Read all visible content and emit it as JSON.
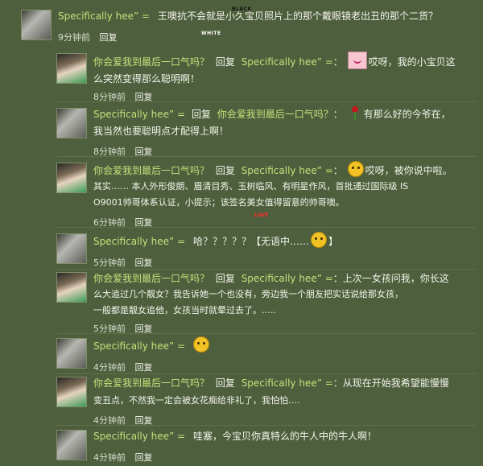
{
  "deco": {
    "black": "BLACK",
    "white": "WHITE",
    "love": "LOVE"
  },
  "comments": [
    {
      "user": "Specifically hee” =",
      "text": "王噢抗不会就是小久宝贝照片上的那个戴眼镜老出丑的那个二货？",
      "time": "9分钟前",
      "reply": "回复"
    },
    {
      "user": "你会爱我到最后一口气吗？",
      "mid": "回复",
      "target": "Specifically hee” =",
      "text1": "：",
      "text2": "哎呀，我的小宝贝这",
      "line2": "么突然变得那么聪明啊！",
      "time": "8分钟前",
      "reply": "回复"
    },
    {
      "user": "Specifically hee” =",
      "mid": "回复",
      "target": "你会爱我到最后一口气吗？",
      "text1": "：",
      "text2": "有那么好的今爷在，",
      "line2": "我当然也要聪明点才配得上啊！",
      "time": "8分钟前",
      "reply": "回复"
    },
    {
      "user": "你会爱我到最后一口气吗？",
      "mid": "回复",
      "target": "Specifically hee” =",
      "text1": "：",
      "text2": "哎呀，被你说中啦。",
      "line2": "其实…… 本人外形俊朗、眉清目秀、玉树临风、有明星作风，首批通过国际级 IS",
      "line3": "O9001帅哥体系认证，小提示；该签名美女值得留意的帅哥噢。",
      "time": "6分钟前",
      "reply": "回复"
    },
    {
      "user": "Specifically hee” =",
      "text1": "哈？？？？？【无语中……",
      "text2": "】",
      "time": "5分钟前",
      "reply": "回复"
    },
    {
      "user": "你会爱我到最后一口气吗？",
      "mid": "回复",
      "target": "Specifically hee” =",
      "text1": "：上次一女孩问我，你长这",
      "line2": "么大追过几个靓女？我告诉她一个也没有，旁边我一个朋友把实话说给那女孩，",
      "line3": "一般都是靓女追他，女孩当时就晕过去了。…..",
      "time": "5分钟前",
      "reply": "回复"
    },
    {
      "user": "Specifically hee” =",
      "time": "4分钟前",
      "reply": "回复"
    },
    {
      "user": "你会爱我到最后一口气吗？",
      "mid": "回复",
      "target": "Specifically hee” =",
      "text1": "：从现在开始我希望能慢慢",
      "line2": "变丑点，不然我一定会被女花痴给非礼了，我怕怕….",
      "time": "4分钟前",
      "reply": "回复"
    },
    {
      "user": "Specifically hee” =",
      "text1": "哇塞，今宝贝你真特么的牛人中的牛人啊！",
      "time": "4分钟前",
      "reply": "回复"
    }
  ]
}
